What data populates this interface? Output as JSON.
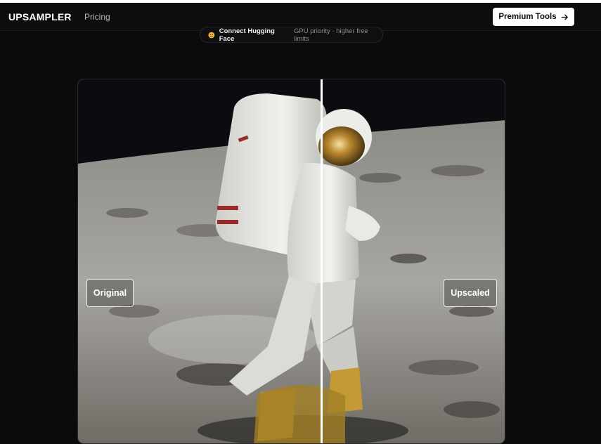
{
  "header": {
    "brand": "UPSAMPLER",
    "nav_pricing": "Pricing",
    "premium_label": "Premium Tools"
  },
  "banner": {
    "title": "Connect Hugging Face",
    "subtitle": "GPU priority · higher free limits"
  },
  "comparison": {
    "left_label": "Original",
    "right_label": "Upscaled",
    "slider_position": 0.57
  },
  "icons": {
    "premium_arrow": "arrow-right-icon",
    "banner_emoji": "hugging-face-icon"
  },
  "colors": {
    "background": "#0b0b0c",
    "button_bg": "#ffffff",
    "divider": "#ffffff"
  }
}
